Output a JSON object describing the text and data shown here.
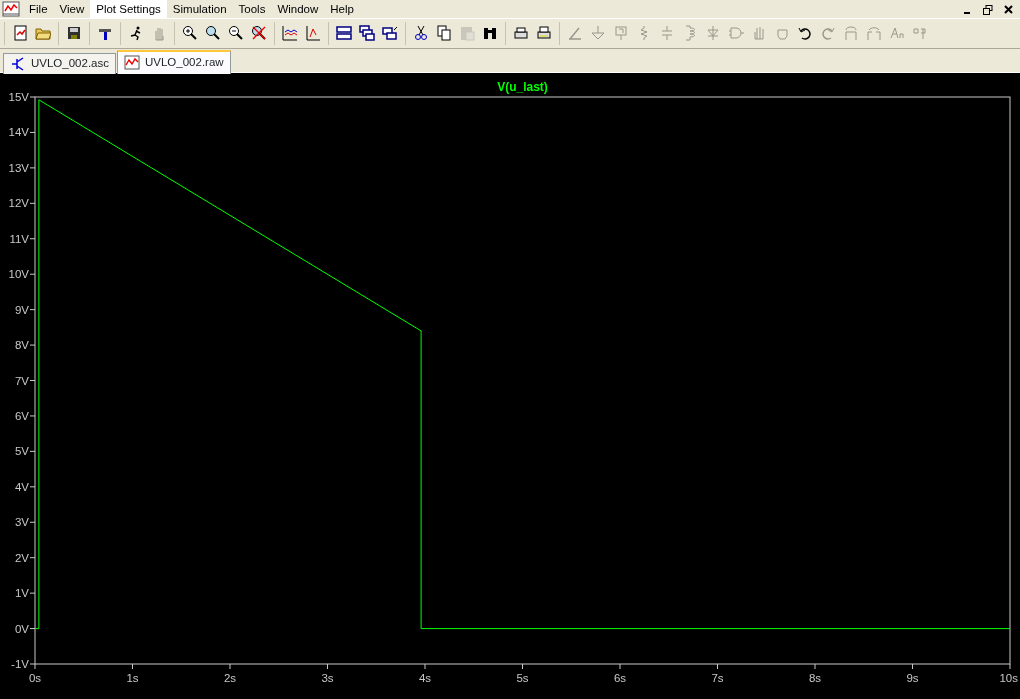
{
  "menu": [
    {
      "label": "File",
      "selected": false
    },
    {
      "label": "View",
      "selected": false
    },
    {
      "label": "Plot Settings",
      "selected": true
    },
    {
      "label": "Simulation",
      "selected": false
    },
    {
      "label": "Tools",
      "selected": false
    },
    {
      "label": "Window",
      "selected": false
    },
    {
      "label": "Help",
      "selected": false
    }
  ],
  "toolbar": [
    [
      {
        "disabled": false
      },
      {
        "disabled": false
      }
    ],
    [
      {
        "disabled": false
      }
    ],
    [
      {
        "disabled": false
      }
    ],
    [
      {
        "disabled": false
      },
      {
        "disabled": true
      }
    ],
    [
      {
        "disabled": false
      },
      {
        "disabled": false
      },
      {
        "disabled": false
      },
      {
        "disabled": false
      }
    ],
    [
      {
        "disabled": false
      },
      {
        "disabled": false
      }
    ],
    [
      {
        "disabled": false
      },
      {
        "disabled": false
      },
      {
        "disabled": false
      }
    ],
    [
      {
        "disabled": false
      },
      {
        "disabled": false
      },
      {
        "disabled": true
      },
      {
        "disabled": false
      }
    ],
    [
      {
        "disabled": false
      },
      {
        "disabled": false
      }
    ],
    [
      {
        "disabled": true
      },
      {
        "disabled": true
      },
      {
        "disabled": true
      },
      {
        "disabled": true
      },
      {
        "disabled": true
      },
      {
        "disabled": true
      },
      {
        "disabled": true
      },
      {
        "disabled": true
      },
      {
        "disabled": true
      },
      {
        "disabled": true
      },
      {
        "disabled": false
      },
      {
        "disabled": true
      },
      {
        "disabled": true
      },
      {
        "disabled": true
      },
      {
        "disabled": true
      },
      {
        "disabled": true
      }
    ]
  ],
  "tabs": [
    {
      "label": "UVLO_002.asc",
      "kind": "schematic",
      "selected": false
    },
    {
      "label": "UVLO_002.raw",
      "kind": "waveform",
      "selected": true
    }
  ],
  "plot": {
    "chart_data": {
      "type": "line",
      "x": [
        0,
        0.04,
        0.04,
        3.96,
        3.96,
        10
      ],
      "series": [
        {
          "name": "V(u_last)",
          "color": "#00ff00",
          "values": [
            0,
            0,
            14.92,
            8.4,
            0,
            0
          ]
        }
      ],
      "xlim": [
        0,
        10
      ],
      "ylim": [
        -1,
        15
      ],
      "xticks": [
        {
          "value": 0,
          "label": "0s"
        },
        {
          "value": 1,
          "label": "1s"
        },
        {
          "value": 2,
          "label": "2s"
        },
        {
          "value": 3,
          "label": "3s"
        },
        {
          "value": 4,
          "label": "4s"
        },
        {
          "value": 5,
          "label": "5s"
        },
        {
          "value": 6,
          "label": "6s"
        },
        {
          "value": 7,
          "label": "7s"
        },
        {
          "value": 8,
          "label": "8s"
        },
        {
          "value": 9,
          "label": "9s"
        },
        {
          "value": 10,
          "label": "10s"
        }
      ],
      "yticks": [
        {
          "value": -1,
          "label": "-1V"
        },
        {
          "value": 0,
          "label": "0V"
        },
        {
          "value": 1,
          "label": "1V"
        },
        {
          "value": 2,
          "label": "2V"
        },
        {
          "value": 3,
          "label": "3V"
        },
        {
          "value": 4,
          "label": "4V"
        },
        {
          "value": 5,
          "label": "5V"
        },
        {
          "value": 6,
          "label": "6V"
        },
        {
          "value": 7,
          "label": "7V"
        },
        {
          "value": 8,
          "label": "8V"
        },
        {
          "value": 9,
          "label": "9V"
        },
        {
          "value": 10,
          "label": "10V"
        },
        {
          "value": 11,
          "label": "11V"
        },
        {
          "value": 12,
          "label": "12V"
        },
        {
          "value": 13,
          "label": "13V"
        },
        {
          "value": 14,
          "label": "14V"
        },
        {
          "value": 15,
          "label": "15V"
        }
      ]
    }
  }
}
